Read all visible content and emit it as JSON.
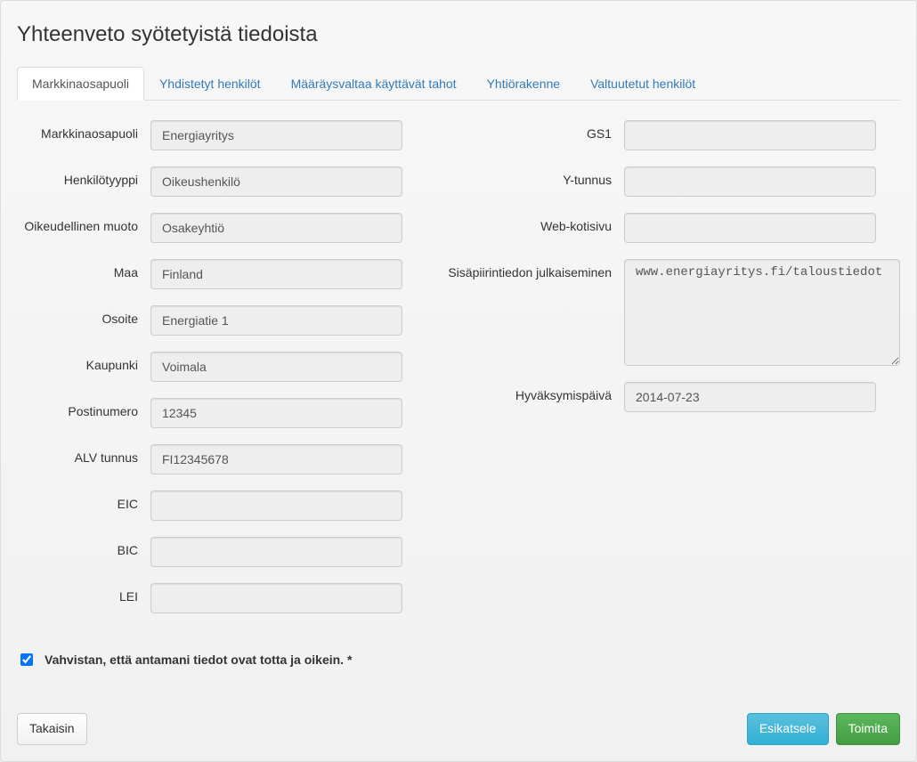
{
  "page_title": "Yhteenveto syötetyistä tiedoista",
  "tabs": [
    {
      "label": "Markkinaosapuoli",
      "active": true
    },
    {
      "label": "Yhdistetyt henkilöt",
      "active": false
    },
    {
      "label": "Määräysvaltaa käyttävät tahot",
      "active": false
    },
    {
      "label": "Yhtiörakenne",
      "active": false
    },
    {
      "label": "Valtuutetut henkilöt",
      "active": false
    }
  ],
  "left_fields": {
    "markkinaosapuoli": {
      "label": "Markkinaosapuoli",
      "value": "Energiayritys"
    },
    "henkilotyyppi": {
      "label": "Henkilötyyppi",
      "value": "Oikeushenkilö"
    },
    "oikeudellinen_muoto": {
      "label": "Oikeudellinen muoto",
      "value": "Osakeyhtiö"
    },
    "maa": {
      "label": "Maa",
      "value": "Finland"
    },
    "osoite": {
      "label": "Osoite",
      "value": "Energiatie 1"
    },
    "kaupunki": {
      "label": "Kaupunki",
      "value": "Voimala"
    },
    "postinumero": {
      "label": "Postinumero",
      "value": "12345"
    },
    "alv_tunnus": {
      "label": "ALV tunnus",
      "value": "FI12345678"
    },
    "eic": {
      "label": "EIC",
      "value": ""
    },
    "bic": {
      "label": "BIC",
      "value": ""
    },
    "lei": {
      "label": "LEI",
      "value": ""
    }
  },
  "right_fields": {
    "gs1": {
      "label": "GS1",
      "value": ""
    },
    "y_tunnus": {
      "label": "Y-tunnus",
      "value": ""
    },
    "web": {
      "label": "Web-kotisivu",
      "value": ""
    },
    "sisapiiri": {
      "label": "Sisäpiirintiedon julkaiseminen",
      "value": "www.energiayritys.fi/taloustiedot"
    },
    "hyvaksymispaiva": {
      "label": "Hyväksymispäivä",
      "value": "2014-07-23"
    }
  },
  "confirm": {
    "checked": true,
    "label": "Vahvistan, että antamani tiedot ovat totta ja oikein. *"
  },
  "buttons": {
    "back": "Takaisin",
    "preview": "Esikatsele",
    "submit": "Toimita"
  }
}
